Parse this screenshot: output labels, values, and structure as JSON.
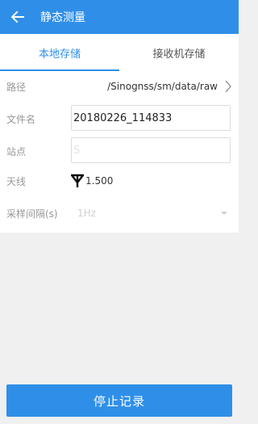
{
  "appbar": {
    "title": "静态测量",
    "back_icon": "arrow-left-icon"
  },
  "tabs": [
    {
      "label": "本地存储",
      "active": true
    },
    {
      "label": "接收机存储",
      "active": false
    }
  ],
  "form": {
    "path": {
      "label": "路径",
      "value": "/Sinognss/sm/data/raw"
    },
    "filename": {
      "label": "文件名",
      "value": "20180226_114833"
    },
    "station": {
      "label": "站点",
      "placeholder": "S"
    },
    "antenna": {
      "label": "天线",
      "value": "1.500",
      "icon": "antenna-icon"
    },
    "interval": {
      "label": "采样间隔(s)",
      "value": "1Hz"
    }
  },
  "actions": {
    "stop_label": "停止记录"
  },
  "colors": {
    "accent": "#2f8fe8"
  }
}
